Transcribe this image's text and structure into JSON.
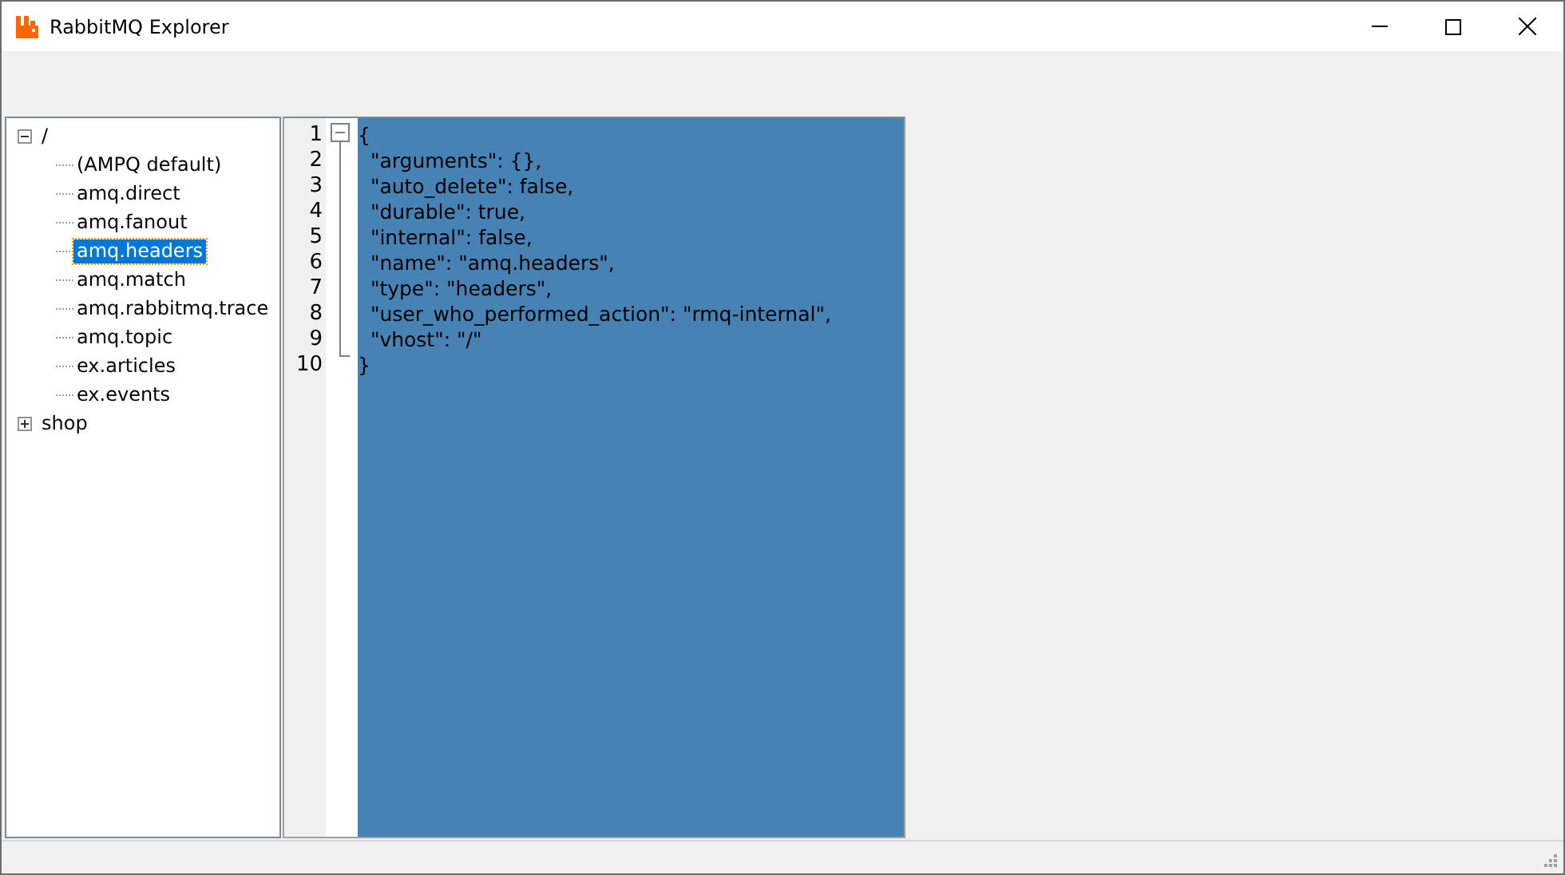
{
  "window": {
    "title": "RabbitMQ Explorer"
  },
  "tree": [
    {
      "label": "/",
      "expanded": true,
      "selected": false,
      "children": [
        {
          "label": "(AMPQ default)",
          "selected": false
        },
        {
          "label": "amq.direct",
          "selected": false
        },
        {
          "label": "amq.fanout",
          "selected": false
        },
        {
          "label": "amq.headers",
          "selected": true
        },
        {
          "label": "amq.match",
          "selected": false
        },
        {
          "label": "amq.rabbitmq.trace",
          "selected": false
        },
        {
          "label": "amq.topic",
          "selected": false
        },
        {
          "label": "ex.articles",
          "selected": false
        },
        {
          "label": "ex.events",
          "selected": false
        }
      ]
    },
    {
      "label": "shop",
      "expanded": false,
      "selected": false
    }
  ],
  "editor": {
    "lines": [
      {
        "number": "1",
        "text": "{"
      },
      {
        "number": "2",
        "text": "  \"arguments\": {},"
      },
      {
        "number": "3",
        "text": "  \"auto_delete\": false,"
      },
      {
        "number": "4",
        "text": "  \"durable\": true,"
      },
      {
        "number": "5",
        "text": "  \"internal\": false,"
      },
      {
        "number": "6",
        "text": "  \"name\": \"amq.headers\","
      },
      {
        "number": "7",
        "text": "  \"type\": \"headers\","
      },
      {
        "number": "8",
        "text": "  \"user_who_performed_action\": \"rmq-internal\","
      },
      {
        "number": "9",
        "text": "  \"vhost\": \"/\""
      },
      {
        "number": "10",
        "text": "}"
      }
    ]
  }
}
